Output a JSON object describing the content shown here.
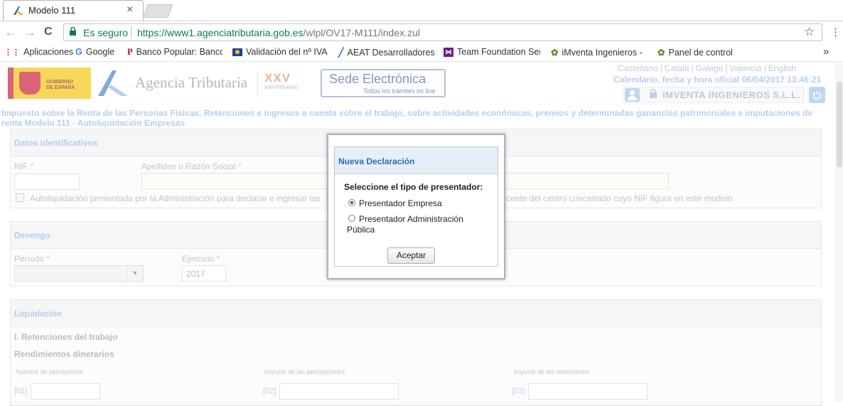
{
  "browser": {
    "tab_title": "Modelo 111",
    "tab_close": "×",
    "secure_label": "Es seguro",
    "url_host": "https://www1.agenciatributaria.gob.es",
    "url_path": "/wlpl/OV17-M111/index.zul",
    "star": "☆",
    "menu": "⋮",
    "back": "←",
    "forward": "→",
    "reload": "C",
    "bookmarks_more": "»",
    "bookmarks": [
      {
        "label": "Aplicaciones",
        "icon": "apps-icon"
      },
      {
        "label": "Google",
        "icon": "google-icon"
      },
      {
        "label": "Banco Popular: Banco",
        "icon": "banco-popular-icon"
      },
      {
        "label": "Validación del nº IVA",
        "icon": "eu-flag-icon"
      },
      {
        "label": "AEAT Desarrolladores",
        "icon": "aeat-icon"
      },
      {
        "label": "Team Foundation Ser",
        "icon": "visual-studio-icon"
      },
      {
        "label": "iMventa Ingenieros -",
        "icon": "imventa-icon"
      },
      {
        "label": "Panel de control",
        "icon": "imventa-icon"
      }
    ]
  },
  "header": {
    "gov_logo_text": "GOBIERNO\nDE ESPAÑA",
    "agency": "Agencia Tributaria",
    "anniversary": "XXV",
    "anniversary_sub": "ANIVERSARIO",
    "sede_title": "Sede Electrónica",
    "sede_sub": "Todos los trámites on line",
    "languages": [
      "Castellano",
      "Català",
      "Galego",
      "Valencià",
      "English"
    ],
    "calendar": "Calendario, fecha y hora oficial 06/04/2017 13:46:21",
    "company": "IMVENTA INGENIEROS S.L.L."
  },
  "doc_title_line1": "Impuesto sobre la Renta de las Personas Físicas. Retenciones e ingresos a cuenta sobre el trabajo, sobre actividades económicas, premios y determinadas ganancias patrimoniales e imputaciones de",
  "doc_title_line2": "renta Modelo 111 - Autoliquidación Empresas",
  "datos": {
    "title": "Datos identificativos",
    "nif_label": "NIF",
    "name_label": "Apellidos o Razón Social",
    "required_mark": "*",
    "checkbox_text_left": "Autoliquidación presentada por la Administración para declarar e ingresar las",
    "checkbox_text_right": "cente del centro concertado cuyo NIF figura en este modelo."
  },
  "devengo": {
    "title": "Devengo",
    "periodo_label": "Período",
    "ejercicio_label": "Ejercicio",
    "ejercicio_value": "2017"
  },
  "liquidacion": {
    "title": "Liquidación",
    "section1": "I. Retenciones del trabajo",
    "subsection": "Rendimientos dinerarios",
    "columns": [
      {
        "label": "Número de perceptores",
        "cell": "[01]"
      },
      {
        "label": "Importe de las percepciones",
        "cell": "[02]"
      },
      {
        "label": "Importe de las retenciones",
        "cell": "[03]"
      }
    ]
  },
  "dialog": {
    "title": "Nueva Declaración",
    "question": "Seleccione el tipo de presentador:",
    "option1": "Presentador Empresa",
    "option2_line1": "Presentador Administración",
    "option2_line2": "Pública",
    "selected": "Presentador Empresa",
    "accept": "Aceptar"
  },
  "colors": {
    "accent": "#2d6bb8",
    "secure": "#0b8043",
    "panel_title": "#90b3df"
  }
}
